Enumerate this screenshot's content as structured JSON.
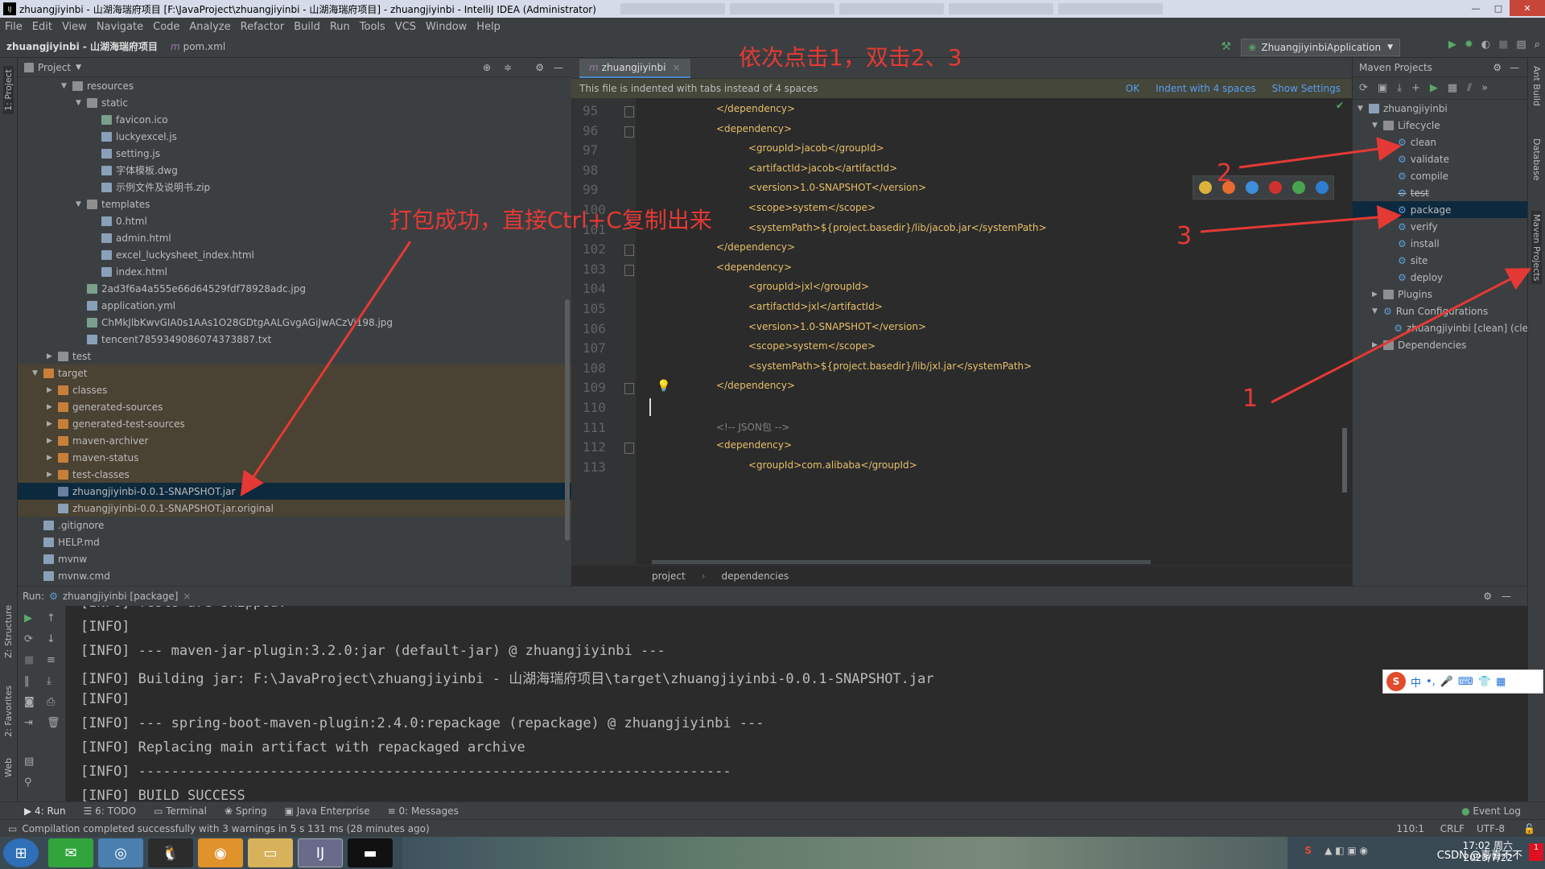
{
  "window": {
    "title": "zhuangjiyinbi - 山湖海瑞府项目 [F:\\JavaProject\\zhuangjiyinbi - 山湖海瑞府项目] - zhuangjiyinbi - IntelliJ IDEA (Administrator)",
    "buttons": [
      "—",
      "□",
      "✕"
    ]
  },
  "menu": [
    "File",
    "Edit",
    "View",
    "Navigate",
    "Code",
    "Analyze",
    "Refactor",
    "Build",
    "Run",
    "Tools",
    "VCS",
    "Window",
    "Help"
  ],
  "breadcrumb": {
    "project": "zhuangjiyinbi - 山湖海瑞府项目",
    "file": "pom.xml"
  },
  "run_config": "ZhuangjiyinbiApplication",
  "left_strip": {
    "project_tab": "1: Project",
    "structure_tab": "Z: Structure",
    "favorites_tab": "2: Favorites",
    "web_tab": "Web"
  },
  "right_strip": {
    "ant": "Ant Build",
    "database": "Database",
    "maven": "Maven Projects"
  },
  "project_panel": {
    "title": "Project",
    "tree": [
      {
        "label": "resources",
        "depth": 2,
        "kind": "fold",
        "arrow": "▼"
      },
      {
        "label": "static",
        "depth": 3,
        "kind": "fold",
        "arrow": "▼"
      },
      {
        "label": "favicon.ico",
        "depth": 4,
        "kind": "img",
        "arrow": ""
      },
      {
        "label": "luckyexcel.js",
        "depth": 4,
        "kind": "file",
        "arrow": ""
      },
      {
        "label": "setting.js",
        "depth": 4,
        "kind": "file",
        "arrow": ""
      },
      {
        "label": "字体模板.dwg",
        "depth": 4,
        "kind": "file",
        "arrow": ""
      },
      {
        "label": "示例文件及说明书.zip",
        "depth": 4,
        "kind": "file",
        "arrow": ""
      },
      {
        "label": "templates",
        "depth": 3,
        "kind": "fold",
        "arrow": "▼"
      },
      {
        "label": "0.html",
        "depth": 4,
        "kind": "file",
        "arrow": ""
      },
      {
        "label": "admin.html",
        "depth": 4,
        "kind": "file",
        "arrow": ""
      },
      {
        "label": "excel_luckysheet_index.html",
        "depth": 4,
        "kind": "file",
        "arrow": ""
      },
      {
        "label": "index.html",
        "depth": 4,
        "kind": "file",
        "arrow": ""
      },
      {
        "label": "2ad3f6a4a555e66d64529fdf78928adc.jpg",
        "depth": 3,
        "kind": "img",
        "arrow": ""
      },
      {
        "label": "application.yml",
        "depth": 3,
        "kind": "file",
        "arrow": ""
      },
      {
        "label": "ChMkJlbKwvGIA0s1AAs1O28GDtgAALGvgAGiJwACzVi198.jpg",
        "depth": 3,
        "kind": "img",
        "arrow": ""
      },
      {
        "label": "tencent7859349086074373887.txt",
        "depth": 3,
        "kind": "file",
        "arrow": ""
      },
      {
        "label": "test",
        "depth": 1,
        "kind": "fold",
        "arrow": "▶"
      },
      {
        "label": "target",
        "depth": 0,
        "kind": "ofold",
        "arrow": "▼"
      },
      {
        "label": "classes",
        "depth": 1,
        "kind": "ofold",
        "arrow": "▶"
      },
      {
        "label": "generated-sources",
        "depth": 1,
        "kind": "ofold",
        "arrow": "▶"
      },
      {
        "label": "generated-test-sources",
        "depth": 1,
        "kind": "ofold",
        "arrow": "▶"
      },
      {
        "label": "maven-archiver",
        "depth": 1,
        "kind": "ofold",
        "arrow": "▶"
      },
      {
        "label": "maven-status",
        "depth": 1,
        "kind": "ofold",
        "arrow": "▶"
      },
      {
        "label": "test-classes",
        "depth": 1,
        "kind": "ofold",
        "arrow": "▶"
      },
      {
        "label": "zhuangjiyinbi-0.0.1-SNAPSHOT.jar",
        "depth": 1,
        "kind": "jar",
        "arrow": ""
      },
      {
        "label": "zhuangjiyinbi-0.0.1-SNAPSHOT.jar.original",
        "depth": 1,
        "kind": "file",
        "arrow": ""
      },
      {
        "label": ".gitignore",
        "depth": 0,
        "kind": "file",
        "arrow": ""
      },
      {
        "label": "HELP.md",
        "depth": 0,
        "kind": "file",
        "arrow": ""
      },
      {
        "label": "mvnw",
        "depth": 0,
        "kind": "file",
        "arrow": ""
      },
      {
        "label": "mvnw.cmd",
        "depth": 0,
        "kind": "file",
        "arrow": ""
      }
    ]
  },
  "editor": {
    "tab": "zhuangjiyinbi",
    "notice": "This file is indented with tabs instead of 4 spaces",
    "notice_links": [
      "OK",
      "Indent with 4 spaces",
      "Show Settings"
    ],
    "lines": [
      {
        "n": "95",
        "indent": 2,
        "text": "</dependency>",
        "kind": "tag"
      },
      {
        "n": "96",
        "indent": 2,
        "text": "<dependency>",
        "kind": "tag"
      },
      {
        "n": "97",
        "indent": 3,
        "text": "<groupId>jacob</groupId>",
        "kind": "tag"
      },
      {
        "n": "98",
        "indent": 3,
        "text": "<artifactId>jacob</artifactId>",
        "kind": "tag"
      },
      {
        "n": "99",
        "indent": 3,
        "text": "<version>1.0-SNAPSHOT</version>",
        "kind": "tag"
      },
      {
        "n": "100",
        "indent": 3,
        "text": "<scope>system</scope>",
        "kind": "tag"
      },
      {
        "n": "101",
        "indent": 3,
        "text": "<systemPath>${project.basedir}/lib/jacob.jar</systemPath>",
        "kind": "tag"
      },
      {
        "n": "102",
        "indent": 2,
        "text": "</dependency>",
        "kind": "tag"
      },
      {
        "n": "103",
        "indent": 2,
        "text": "<dependency>",
        "kind": "tag"
      },
      {
        "n": "104",
        "indent": 3,
        "text": "<groupId>jxl</groupId>",
        "kind": "tag"
      },
      {
        "n": "105",
        "indent": 3,
        "text": "<artifactId>jxl</artifactId>",
        "kind": "tag"
      },
      {
        "n": "106",
        "indent": 3,
        "text": "<version>1.0-SNAPSHOT</version>",
        "kind": "tag"
      },
      {
        "n": "107",
        "indent": 3,
        "text": "<scope>system</scope>",
        "kind": "tag"
      },
      {
        "n": "108",
        "indent": 3,
        "text": "<systemPath>${project.basedir}/lib/jxl.jar</systemPath>",
        "kind": "tag"
      },
      {
        "n": "109",
        "indent": 2,
        "text": "</dependency>",
        "kind": "tag"
      },
      {
        "n": "110",
        "indent": 0,
        "text": "",
        "kind": "tag"
      },
      {
        "n": "111",
        "indent": 2,
        "text": "<!-- JSON包 -->",
        "kind": "comment"
      },
      {
        "n": "112",
        "indent": 2,
        "text": "<dependency>",
        "kind": "tag"
      },
      {
        "n": "113",
        "indent": 3,
        "text": "<groupId>com.alibaba</groupId>",
        "kind": "tag"
      }
    ],
    "breadcrumb": [
      "project",
      "dependencies"
    ]
  },
  "maven": {
    "title": "Maven Projects",
    "tree": [
      {
        "label": "zhuangjiyinbi",
        "depth": 0,
        "arrow": "▼",
        "icon": "module"
      },
      {
        "label": "Lifecycle",
        "depth": 1,
        "arrow": "▼",
        "icon": "folder"
      },
      {
        "label": "clean",
        "depth": 2,
        "arrow": "",
        "icon": "gear"
      },
      {
        "label": "validate",
        "depth": 2,
        "arrow": "",
        "icon": "gear"
      },
      {
        "label": "compile",
        "depth": 2,
        "arrow": "",
        "icon": "gear"
      },
      {
        "label": "test",
        "depth": 2,
        "arrow": "",
        "icon": "gear"
      },
      {
        "label": "package",
        "depth": 2,
        "arrow": "",
        "icon": "gear"
      },
      {
        "label": "verify",
        "depth": 2,
        "arrow": "",
        "icon": "gear"
      },
      {
        "label": "install",
        "depth": 2,
        "arrow": "",
        "icon": "gear"
      },
      {
        "label": "site",
        "depth": 2,
        "arrow": "",
        "icon": "gear"
      },
      {
        "label": "deploy",
        "depth": 2,
        "arrow": "",
        "icon": "gear"
      },
      {
        "label": "Plugins",
        "depth": 1,
        "arrow": "▶",
        "icon": "folder"
      },
      {
        "label": "Run Configurations",
        "depth": 1,
        "arrow": "▼",
        "icon": "gear"
      },
      {
        "label": "zhuangjiyinbi [clean] (cle",
        "depth": 2,
        "arrow": "",
        "icon": "gear"
      },
      {
        "label": "Dependencies",
        "depth": 1,
        "arrow": "▶",
        "icon": "folder"
      }
    ]
  },
  "run_panel": {
    "label": "Run:",
    "tab": "zhuangjiyinbi [package]",
    "lines": [
      "[INFO] Tests are skipped.",
      "[INFO]",
      "[INFO] --- maven-jar-plugin:3.2.0:jar (default-jar) @ zhuangjiyinbi ---",
      "[INFO] Building jar: F:\\JavaProject\\zhuangjiyinbi - 山湖海瑞府项目\\target\\zhuangjiyinbi-0.0.1-SNAPSHOT.jar",
      "[INFO]",
      "[INFO] --- spring-boot-maven-plugin:2.4.0:repackage (repackage) @ zhuangjiyinbi ---",
      "[INFO] Replacing main artifact with repackaged archive",
      "[INFO] ------------------------------------------------------------------------",
      "[INFO] BUILD SUCCESS"
    ]
  },
  "bottom_tabs": [
    "4: Run",
    "6: TODO",
    "Terminal",
    "Spring",
    "Java Enterprise",
    "0: Messages"
  ],
  "event_log": "Event Log",
  "status": {
    "message": "Compilation completed successfully with 3 warnings in 5 s 131 ms (28 minutes ago)",
    "position": "110:1",
    "line_sep": "CRLF",
    "encoding": "UTF-8"
  },
  "ime": {
    "lang": "中",
    "items": [
      "•,",
      "🎤",
      "⌨",
      "👕",
      "▦"
    ]
  },
  "taskbar": {
    "time": "17:02 周六",
    "date": "2023/7/22",
    "watermark": "CSDN @喜喜不不"
  },
  "annotations": {
    "top_instruction": "依次点击1，双击2、3",
    "left_instruction": "打包成功，直接Ctrl+C复制出来",
    "n1": "1",
    "n2": "2",
    "n3": "3"
  },
  "colors": {
    "accent": "#e53935",
    "selection": "#0d293e",
    "maven_selection": "#0d293e"
  }
}
